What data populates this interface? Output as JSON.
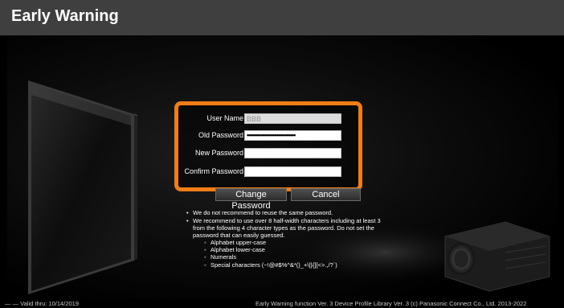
{
  "window": {
    "title": "Early Warning"
  },
  "form": {
    "user_name_label": "User Name",
    "user_name_value": "BBB",
    "old_password_label": "Old Password",
    "old_password_value": "••••••••••••••••••••••••••••",
    "new_password_label": "New Password",
    "new_password_value": "",
    "confirm_password_label": "Confirm Password",
    "confirm_password_value": "",
    "accent_color": "#f07d15"
  },
  "buttons": {
    "change_password": "Change Password",
    "cancel": "Cancel"
  },
  "notes": {
    "bullet1": "We do not recommend to reuse the same password.",
    "bullet2_line1": "We recommend to use over 8 half-width characters including at least 3",
    "bullet2_line2": "from the following 4 character types as the password. Do not set the",
    "bullet2_line3": "password that can easily guessed.",
    "types": [
      "Alphabet upper-case",
      "Alphabet lower-case",
      "Numerals",
      "Special characters (~!@#$%^&*()_+\\|}{][<>.,/?`)"
    ]
  },
  "footer": {
    "valid_thru": "— —  Valid thru: 10/14/2019",
    "versions": "Early Warning function Ver. 3        Device Profile Library Ver. 3        (c) Panasonic Connect Co., Ltd. 2013-2022"
  }
}
